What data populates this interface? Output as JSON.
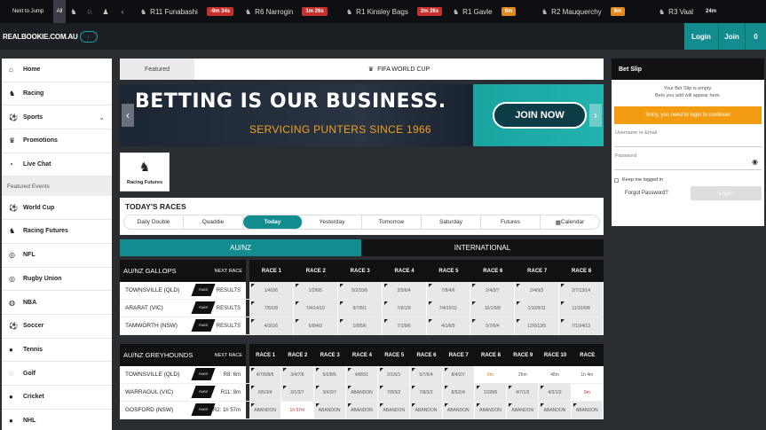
{
  "topbar": {
    "next_to_jump": "Next to Jump",
    "all": "All",
    "races": [
      {
        "venue": "R11 Funabashi",
        "time": "-9m 34s",
        "style": "red",
        "icon": "horse-icon"
      },
      {
        "venue": "R6 Narrogin",
        "time": "1m 26s",
        "style": "red",
        "icon": "horse-icon"
      },
      {
        "venue": "R1 Kinsley Bags",
        "time": "2m 26s",
        "style": "red",
        "icon": "horse-icon"
      },
      {
        "venue": "R1 Gavle",
        "time": "9m",
        "style": "orange",
        "icon": "horse-icon"
      },
      {
        "venue": "R2 Mauquerchy",
        "time": "9m",
        "style": "orange",
        "icon": "horse-icon"
      },
      {
        "venue": "R3 Vaal",
        "time": "24m",
        "style": "plain",
        "icon": "horse-icon"
      }
    ]
  },
  "header": {
    "logo": "REALBOOKIE.COM.AU",
    "login": "Login",
    "join": "Join",
    "balance": "0"
  },
  "sidebar": {
    "items_top": [
      {
        "label": "Home",
        "icon": "home-icon",
        "glyph": "⌂"
      },
      {
        "label": "Racing",
        "icon": "horse-icon",
        "glyph": "♞"
      },
      {
        "label": "Sports",
        "icon": "soccer-ball-icon",
        "glyph": "⚽",
        "chevron": true
      },
      {
        "label": "Promotions",
        "icon": "trophy-icon",
        "glyph": "♛"
      },
      {
        "label": "Live Chat",
        "icon": "chat-icon",
        "glyph": "◔"
      }
    ],
    "group_label": "Featured Events",
    "items_bottom": [
      {
        "label": "World Cup",
        "icon": "soccer-ball-icon",
        "glyph": "⚽"
      },
      {
        "label": "Racing Futures",
        "icon": "horse-icon",
        "glyph": "♞"
      },
      {
        "label": "NFL",
        "icon": "football-icon",
        "glyph": "◎"
      },
      {
        "label": "Rugby Union",
        "icon": "rugby-ball-icon",
        "glyph": "◎"
      },
      {
        "label": "NBA",
        "icon": "basketball-icon",
        "glyph": "◍"
      },
      {
        "label": "Soccer",
        "icon": "soccer-ball-icon",
        "glyph": "⚽"
      },
      {
        "label": "Tennis",
        "icon": "tennis-ball-icon",
        "glyph": "●"
      },
      {
        "label": "Golf",
        "icon": "golf-icon",
        "glyph": "◌"
      },
      {
        "label": "Cricket",
        "icon": "cricket-icon",
        "glyph": "●"
      },
      {
        "label": "NHL",
        "icon": "hockey-icon",
        "glyph": "●"
      }
    ]
  },
  "main": {
    "tab_featured": "Featured",
    "tab_fifa": "FIFA WORLD CUP",
    "banner": {
      "headline": "BETTING IS OUR BUSINESS.",
      "sub": "SERVICING PUNTERS SINCE 1966",
      "join": "JOIN NOW"
    },
    "racing_futures": "Racing Futures",
    "todays_races": "TODAY'S RACES",
    "day_tabs": [
      "Daily Double",
      "Quaddie",
      "Today",
      "Yesterday",
      "Tomorrow",
      "Saturday",
      "Futures",
      "Calendar"
    ],
    "region_au": "AU/NZ",
    "region_intl": "INTERNATIONAL",
    "gallops": {
      "title": "AU/NZ GALLOPS",
      "next_race": "NEXT RACE",
      "cols": [
        "RACE 1",
        "RACE 2",
        "RACE 3",
        "RACE 4",
        "RACE 5",
        "RACE 6",
        "RACE 7",
        "RACE 8"
      ],
      "rows": [
        {
          "venue": "TOWNSVILLE (QLD)",
          "next": "RESULTS",
          "cells": [
            "1/4/2/6",
            "1/2/6/5",
            "5/2/10/6",
            "2/5/6/4",
            "7/8/4/6",
            "2/4/3/7",
            "2/4/9/3",
            "2/7/13/14"
          ]
        },
        {
          "venue": "ARARAT (VIC)",
          "next": "RESULTS",
          "cells": [
            "7/5/1/8",
            "7/4/14/10",
            "9/7/8/1",
            "7/6/1/9",
            "7/4/10/11",
            "10/1/9/8",
            "1/10/9/11",
            "11/10/9/8"
          ]
        },
        {
          "venue": "TAMWORTH (NSW)",
          "next": "RESULTS",
          "cells": [
            "4/3/1/6",
            "6/8/4/3",
            "1/9/5/6",
            "7/1/9/6",
            "4/1/6/5",
            "5/7/6/4",
            "12/6/13/5",
            "7/10/4/13"
          ]
        }
      ]
    },
    "greyhounds": {
      "title": "AU/NZ GREYHOUNDS",
      "next_race": "NEXT RACE",
      "cols": [
        "RACE 1",
        "RACE 2",
        "RACE 3",
        "RACE 4",
        "RACE 5",
        "RACE 6",
        "RACE 7",
        "RACE 8",
        "RACE 9",
        "RACE 10",
        "RACE"
      ],
      "rows": [
        {
          "venue": "TOWNSVILLE (QLD)",
          "next": "R8: 6m",
          "cells": [
            "4/7/6/8/5",
            "3/4/7/6",
            "5/2/8/6",
            "4/8/6/1",
            "2/1/6/1",
            "5/7/6/4",
            "8/4/2/7",
            "6m",
            "26m",
            "48m",
            "1h 4m"
          ],
          "styles": [
            "",
            "",
            "",
            "",
            "",
            "",
            "",
            "orange w",
            "w",
            "w",
            "w"
          ]
        },
        {
          "venue": "WARRAGUL (VIC)",
          "next": "R11: 9m",
          "cells": [
            "6/5/3/4",
            "2/1/3/7",
            "3/4/2/7",
            "ABANDON",
            "7/8/3/2",
            "7/8/3/2",
            "8/5/2/4",
            "1/2/8/6",
            "4/7/1/2",
            "4/3/1/2",
            "9m"
          ],
          "styles": [
            "",
            "",
            "",
            "",
            "",
            "",
            "",
            "",
            "",
            "",
            "red w"
          ]
        },
        {
          "venue": "GOSFORD (NSW)",
          "next": "R2: 1h 57m",
          "cells": [
            "ABANDON",
            "1h 57m",
            "ABANDON",
            "ABANDON",
            "ABANDON",
            "ABANDON",
            "ABANDON",
            "ABANDON",
            "ABANDON",
            "ABANDON",
            "ABANDON"
          ],
          "styles": [
            "",
            "red w",
            "",
            "",
            "",
            "",
            "",
            "",
            "",
            "",
            ""
          ]
        }
      ]
    }
  },
  "betslip": {
    "title": "Bet Slip",
    "empty1": "Your Bet Slip is empty.",
    "empty2": "Bets you add will appear here.",
    "warn": "Sorry, you need to login to continue!",
    "username": "Username or Email",
    "password": "Password",
    "keep": "Keep me logged in",
    "forgot": "Forgot Password?",
    "login": "Login"
  }
}
